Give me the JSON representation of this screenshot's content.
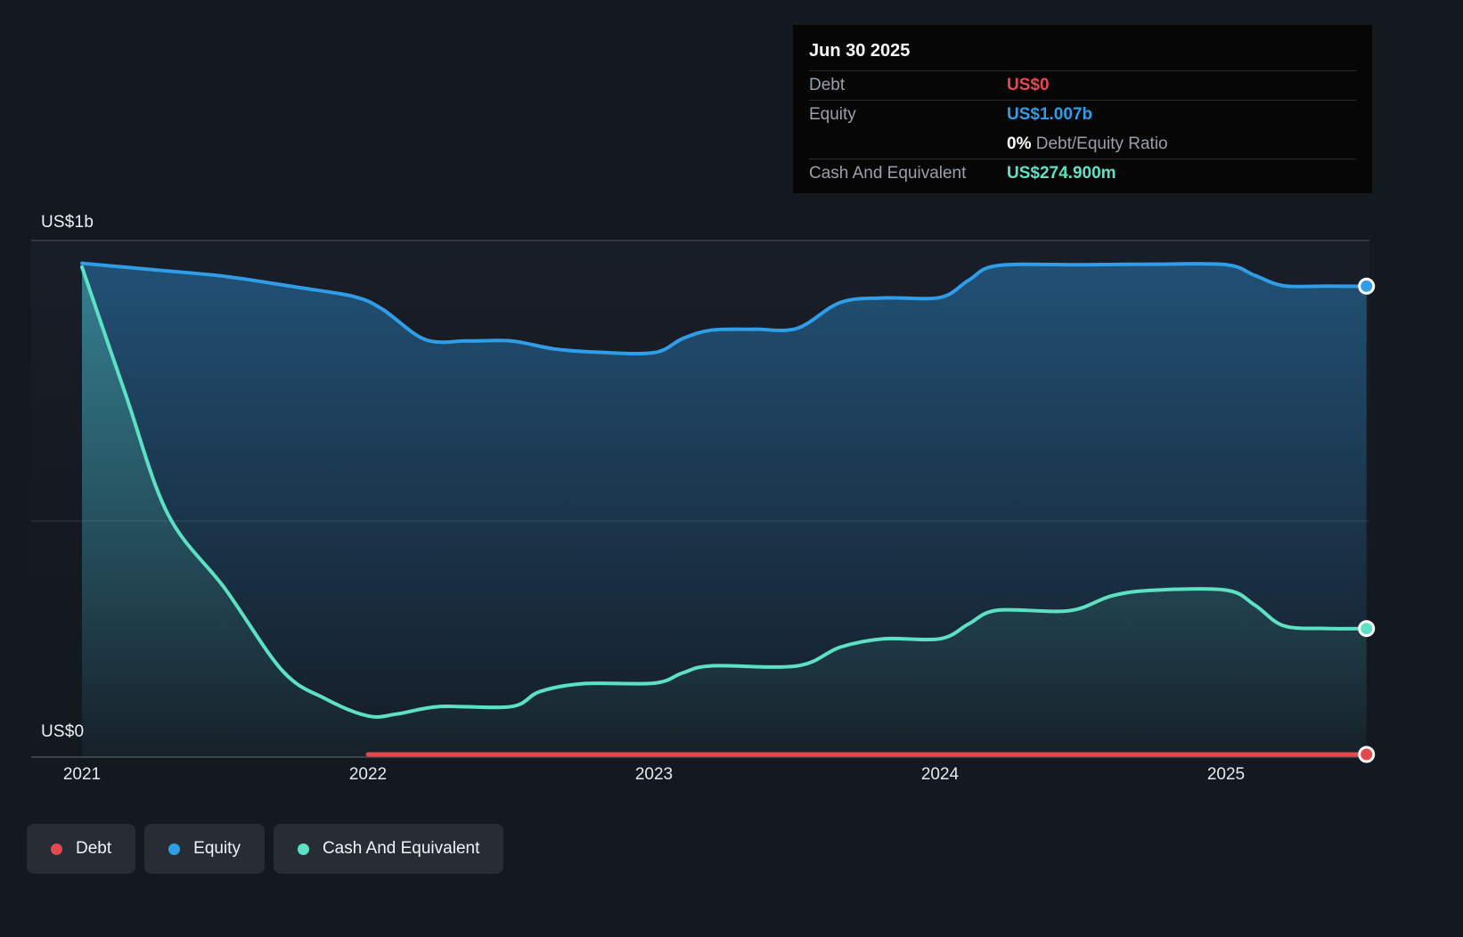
{
  "colors": {
    "page_bg": "#14181f",
    "debt": "#e5484d",
    "equity": "#2f9de8",
    "cash": "#5de1c5",
    "grid_top": "#3a4048",
    "grid_mid": "#333940",
    "axis": "#49515b",
    "tooltip_bg": "#060606",
    "tooltip_label": "#98a0a8",
    "legend_pill_bg": "#282d35"
  },
  "tooltip": {
    "date": "Jun 30 2025",
    "rows": [
      {
        "label": "Debt",
        "value": "US$0",
        "color_key": "debt"
      },
      {
        "label": "Equity",
        "value": "US$1.007b",
        "color_key": "equity"
      },
      {
        "ratio_bold": "0%",
        "ratio_text": "Debt/Equity Ratio"
      },
      {
        "label": "Cash And Equivalent",
        "value": "US$274.900m",
        "color_key": "cash"
      }
    ]
  },
  "axis": {
    "y_top_label": "US$1b",
    "y_bottom_label": "US$0",
    "x_labels": [
      {
        "label": "2021",
        "year": 2021
      },
      {
        "label": "2022",
        "year": 2022
      },
      {
        "label": "2023",
        "year": 2023
      },
      {
        "label": "2024",
        "year": 2024
      },
      {
        "label": "2025",
        "year": 2025
      }
    ]
  },
  "legend": [
    {
      "label": "Debt",
      "color_key": "debt"
    },
    {
      "label": "Equity",
      "color_key": "equity"
    },
    {
      "label": "Cash And Equivalent",
      "color_key": "cash"
    }
  ],
  "chart_data": {
    "type": "area",
    "x_unit": "calendar year (fractional)",
    "y_unit": "US$ billions",
    "x_range": [
      2021.0,
      2025.49
    ],
    "y_range": [
      0,
      1.1
    ],
    "y_gridlines_billions": [
      0,
      0.5,
      1.0
    ],
    "legend_position": "bottom-left",
    "series": [
      {
        "name": "Equity",
        "color_key": "equity",
        "latest_label": "US$1.007b",
        "points": [
          [
            2021.0,
            1.056
          ],
          [
            2021.25,
            1.042
          ],
          [
            2021.5,
            1.028
          ],
          [
            2021.75,
            1.005
          ],
          [
            2021.95,
            0.985
          ],
          [
            2022.05,
            0.958
          ],
          [
            2022.2,
            0.893
          ],
          [
            2022.35,
            0.89
          ],
          [
            2022.5,
            0.89
          ],
          [
            2022.65,
            0.873
          ],
          [
            2022.8,
            0.866
          ],
          [
            2023.0,
            0.865
          ],
          [
            2023.1,
            0.895
          ],
          [
            2023.2,
            0.913
          ],
          [
            2023.35,
            0.915
          ],
          [
            2023.5,
            0.917
          ],
          [
            2023.65,
            0.972
          ],
          [
            2023.8,
            0.982
          ],
          [
            2024.0,
            0.983
          ],
          [
            2024.1,
            1.02
          ],
          [
            2024.2,
            1.051
          ],
          [
            2024.5,
            1.053
          ],
          [
            2024.75,
            1.054
          ],
          [
            2025.0,
            1.053
          ],
          [
            2025.1,
            1.03
          ],
          [
            2025.2,
            1.008
          ],
          [
            2025.35,
            1.007
          ],
          [
            2025.49,
            1.007
          ]
        ]
      },
      {
        "name": "Cash And Equivalent",
        "color_key": "cash",
        "latest_label": "US$274.900m",
        "points": [
          [
            2021.0,
            1.048
          ],
          [
            2021.15,
            0.78
          ],
          [
            2021.3,
            0.52
          ],
          [
            2021.5,
            0.36
          ],
          [
            2021.7,
            0.185
          ],
          [
            2021.85,
            0.125
          ],
          [
            2022.0,
            0.088
          ],
          [
            2022.1,
            0.092
          ],
          [
            2022.25,
            0.108
          ],
          [
            2022.5,
            0.108
          ],
          [
            2022.6,
            0.14
          ],
          [
            2022.75,
            0.157
          ],
          [
            2023.0,
            0.158
          ],
          [
            2023.1,
            0.18
          ],
          [
            2023.2,
            0.195
          ],
          [
            2023.5,
            0.195
          ],
          [
            2023.65,
            0.235
          ],
          [
            2023.8,
            0.253
          ],
          [
            2024.0,
            0.253
          ],
          [
            2024.1,
            0.285
          ],
          [
            2024.2,
            0.314
          ],
          [
            2024.45,
            0.313
          ],
          [
            2024.6,
            0.345
          ],
          [
            2024.75,
            0.357
          ],
          [
            2025.0,
            0.357
          ],
          [
            2025.1,
            0.325
          ],
          [
            2025.2,
            0.281
          ],
          [
            2025.35,
            0.275
          ],
          [
            2025.49,
            0.2749
          ]
        ]
      },
      {
        "name": "Debt",
        "color_key": "debt",
        "latest_label": "US$0",
        "points": [
          [
            2022.0,
            0
          ],
          [
            2025.49,
            0
          ]
        ]
      }
    ]
  }
}
